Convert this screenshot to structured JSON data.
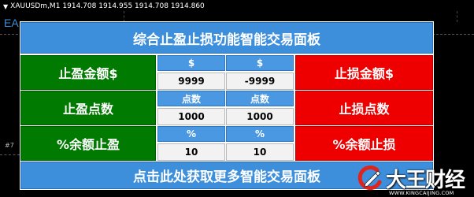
{
  "chart": {
    "symbol": "XAUUSDm,M1",
    "ohlc": "1914.708 1914.955 1914.708 1914.860",
    "ghost_text": "EA",
    "side_mark": "#7"
  },
  "panel": {
    "title": "综合止盈止损功能智能交易面板",
    "footer": "点击此处获取更多智能交易面板",
    "rows": [
      {
        "left_label": "止盈金额$",
        "header1": "$",
        "value1": "9999",
        "header2": "$",
        "value2": "-9999",
        "right_label": "止损金额$"
      },
      {
        "left_label": "止盈点数",
        "header1": "点数",
        "value1": "1000",
        "header2": "点数",
        "value2": "1000",
        "right_label": "止损点数"
      },
      {
        "left_label": "%余额止盈",
        "header1": "%",
        "value1": "10",
        "header2": "%",
        "value2": "10",
        "right_label": "%余额止损"
      }
    ]
  },
  "watermark": {
    "brand": "大王财经",
    "url": "WWW.KINGCAIJING.COM"
  },
  "colors": {
    "accent_blue": "#3d8fdc",
    "take_profit_green": "#007a00",
    "stop_loss_red": "#ee0000"
  }
}
